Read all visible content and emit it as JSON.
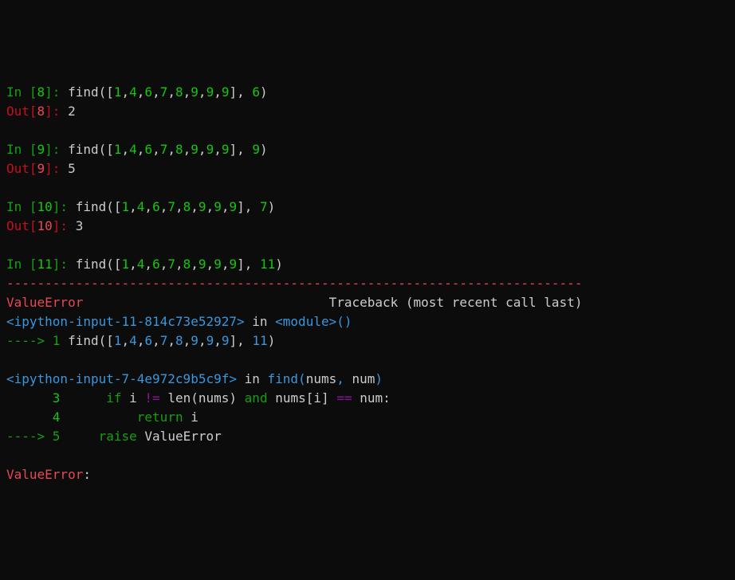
{
  "cells": [
    {
      "in_prompt": "In [",
      "in_num": "8",
      "in_close": "]: ",
      "call_fn": "find",
      "call_open": "([",
      "args": [
        {
          "t": "1",
          "c": "bgreen"
        },
        {
          "t": ",",
          "c": "white"
        },
        {
          "t": "4",
          "c": "bgreen"
        },
        {
          "t": ",",
          "c": "white"
        },
        {
          "t": "6",
          "c": "bgreen"
        },
        {
          "t": ",",
          "c": "white"
        },
        {
          "t": "7",
          "c": "bgreen"
        },
        {
          "t": ",",
          "c": "white"
        },
        {
          "t": "8",
          "c": "bgreen"
        },
        {
          "t": ",",
          "c": "white"
        },
        {
          "t": "9",
          "c": "bgreen"
        },
        {
          "t": ",",
          "c": "white"
        },
        {
          "t": "9",
          "c": "bgreen"
        },
        {
          "t": ",",
          "c": "white"
        },
        {
          "t": "9",
          "c": "bgreen"
        },
        {
          "t": "], ",
          "c": "white"
        },
        {
          "t": "6",
          "c": "bgreen"
        },
        {
          "t": ")",
          "c": "white"
        }
      ],
      "out_prompt": "Out[",
      "out_num": "8",
      "out_close": "]: ",
      "out_val": "2"
    },
    {
      "in_prompt": "In [",
      "in_num": "9",
      "in_close": "]: ",
      "call_fn": "find",
      "call_open": "([",
      "args": [
        {
          "t": "1",
          "c": "bgreen"
        },
        {
          "t": ",",
          "c": "white"
        },
        {
          "t": "4",
          "c": "bgreen"
        },
        {
          "t": ",",
          "c": "white"
        },
        {
          "t": "6",
          "c": "bgreen"
        },
        {
          "t": ",",
          "c": "white"
        },
        {
          "t": "7",
          "c": "bgreen"
        },
        {
          "t": ",",
          "c": "white"
        },
        {
          "t": "8",
          "c": "bgreen"
        },
        {
          "t": ",",
          "c": "white"
        },
        {
          "t": "9",
          "c": "bgreen"
        },
        {
          "t": ",",
          "c": "white"
        },
        {
          "t": "9",
          "c": "bgreen"
        },
        {
          "t": ",",
          "c": "white"
        },
        {
          "t": "9",
          "c": "bgreen"
        },
        {
          "t": "], ",
          "c": "white"
        },
        {
          "t": "9",
          "c": "bgreen"
        },
        {
          "t": ")",
          "c": "white"
        }
      ],
      "out_prompt": "Out[",
      "out_num": "9",
      "out_close": "]: ",
      "out_val": "5"
    },
    {
      "in_prompt": "In [",
      "in_num": "10",
      "in_close": "]: ",
      "call_fn": "find",
      "call_open": "([",
      "args": [
        {
          "t": "1",
          "c": "bgreen"
        },
        {
          "t": ",",
          "c": "white"
        },
        {
          "t": "4",
          "c": "bgreen"
        },
        {
          "t": ",",
          "c": "white"
        },
        {
          "t": "6",
          "c": "bgreen"
        },
        {
          "t": ",",
          "c": "white"
        },
        {
          "t": "7",
          "c": "bgreen"
        },
        {
          "t": ",",
          "c": "white"
        },
        {
          "t": "8",
          "c": "bgreen"
        },
        {
          "t": ",",
          "c": "white"
        },
        {
          "t": "9",
          "c": "bgreen"
        },
        {
          "t": ",",
          "c": "white"
        },
        {
          "t": "9",
          "c": "bgreen"
        },
        {
          "t": ",",
          "c": "white"
        },
        {
          "t": "9",
          "c": "bgreen"
        },
        {
          "t": "], ",
          "c": "white"
        },
        {
          "t": "7",
          "c": "bgreen"
        },
        {
          "t": ")",
          "c": "white"
        }
      ],
      "out_prompt": "Out[",
      "out_num": "10",
      "out_close": "]: ",
      "out_val": "3"
    },
    {
      "in_prompt": "In [",
      "in_num": "11",
      "in_close": "]: ",
      "call_fn": "find",
      "call_open": "([",
      "args": [
        {
          "t": "1",
          "c": "bgreen"
        },
        {
          "t": ",",
          "c": "white"
        },
        {
          "t": "4",
          "c": "bgreen"
        },
        {
          "t": ",",
          "c": "white"
        },
        {
          "t": "6",
          "c": "bgreen"
        },
        {
          "t": ",",
          "c": "white"
        },
        {
          "t": "7",
          "c": "bgreen"
        },
        {
          "t": ",",
          "c": "white"
        },
        {
          "t": "8",
          "c": "bgreen"
        },
        {
          "t": ",",
          "c": "white"
        },
        {
          "t": "9",
          "c": "bgreen"
        },
        {
          "t": ",",
          "c": "white"
        },
        {
          "t": "9",
          "c": "bgreen"
        },
        {
          "t": ",",
          "c": "white"
        },
        {
          "t": "9",
          "c": "bgreen"
        },
        {
          "t": "], ",
          "c": "white"
        },
        {
          "t": "11",
          "c": "bgreen"
        },
        {
          "t": ")",
          "c": "white"
        }
      ],
      "error": true
    }
  ],
  "tb": {
    "dashes": "---------------------------------------------------------------------------",
    "err_name": "ValueError",
    "tb_header_pad": "                                ",
    "tb_header": "Traceback (most recent call last)",
    "frame1_src": "<ipython-input-11-814c73e52927>",
    "in_word": " in ",
    "frame1_fn": "<module>",
    "frame1_args": "()",
    "arrow1": "----> 1",
    "frame1_code": [
      {
        "t": " find",
        "c": "white"
      },
      {
        "t": "(",
        "c": "white"
      },
      {
        "t": "[",
        "c": "white"
      },
      {
        "t": "1",
        "c": "cyan"
      },
      {
        "t": ",",
        "c": "white"
      },
      {
        "t": "4",
        "c": "cyan"
      },
      {
        "t": ",",
        "c": "white"
      },
      {
        "t": "6",
        "c": "cyan"
      },
      {
        "t": ",",
        "c": "white"
      },
      {
        "t": "7",
        "c": "cyan"
      },
      {
        "t": ",",
        "c": "white"
      },
      {
        "t": "8",
        "c": "cyan"
      },
      {
        "t": ",",
        "c": "white"
      },
      {
        "t": "9",
        "c": "cyan"
      },
      {
        "t": ",",
        "c": "white"
      },
      {
        "t": "9",
        "c": "cyan"
      },
      {
        "t": ",",
        "c": "white"
      },
      {
        "t": "9",
        "c": "cyan"
      },
      {
        "t": "]",
        "c": "white"
      },
      {
        "t": ",",
        "c": "white"
      },
      {
        "t": " ",
        "c": "white"
      },
      {
        "t": "11",
        "c": "cyan"
      },
      {
        "t": ")",
        "c": "white"
      }
    ],
    "frame2_src": "<ipython-input-7-4e972c9b5c9f>",
    "frame2_fn": "find",
    "frame2_args_open": "(",
    "frame2_arg1": "nums",
    "frame2_comma": ", ",
    "frame2_arg2": "num",
    "frame2_args_close": ")",
    "src_lines": [
      {
        "num": "3",
        "prefix_pad": "      ",
        "num_pad": " ",
        "code": [
          {
            "t": "     ",
            "c": "white"
          },
          {
            "t": "if",
            "c": "green"
          },
          {
            "t": " i ",
            "c": "white"
          },
          {
            "t": "!=",
            "c": "purple"
          },
          {
            "t": " len",
            "c": "white"
          },
          {
            "t": "(",
            "c": "white"
          },
          {
            "t": "nums",
            "c": "white"
          },
          {
            "t": ")",
            "c": "white"
          },
          {
            "t": " ",
            "c": "white"
          },
          {
            "t": "and",
            "c": "green"
          },
          {
            "t": " nums",
            "c": "white"
          },
          {
            "t": "[",
            "c": "white"
          },
          {
            "t": "i",
            "c": "white"
          },
          {
            "t": "]",
            "c": "white"
          },
          {
            "t": " ",
            "c": "white"
          },
          {
            "t": "==",
            "c": "purple"
          },
          {
            "t": " num",
            "c": "white"
          },
          {
            "t": ":",
            "c": "white"
          }
        ]
      },
      {
        "num": "4",
        "prefix_pad": "      ",
        "num_pad": " ",
        "code": [
          {
            "t": "         ",
            "c": "white"
          },
          {
            "t": "return",
            "c": "green"
          },
          {
            "t": " i",
            "c": "white"
          }
        ]
      },
      {
        "arrow": "----> 5",
        "num_pad": " ",
        "code": [
          {
            "t": "    ",
            "c": "white"
          },
          {
            "t": "raise",
            "c": "green"
          },
          {
            "t": " ValueError",
            "c": "white"
          }
        ]
      }
    ],
    "final_err": "ValueError",
    "final_colon": ": "
  }
}
